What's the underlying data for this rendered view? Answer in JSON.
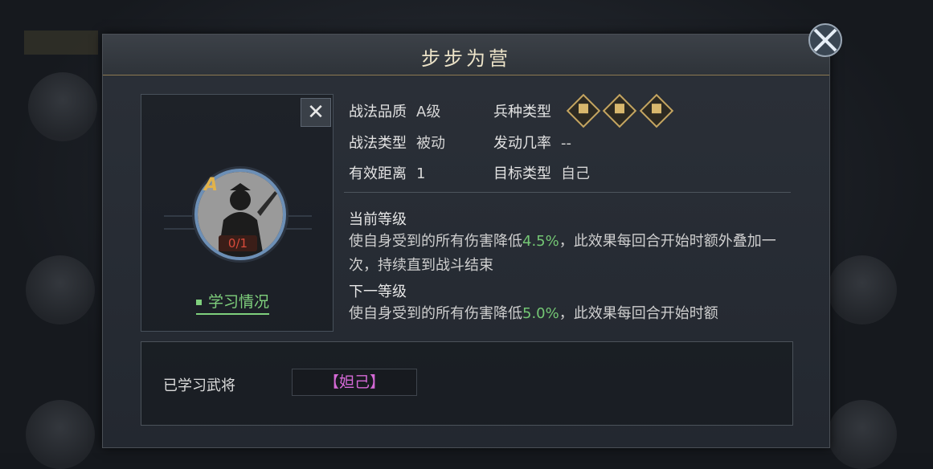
{
  "dialog": {
    "title": "步步为营"
  },
  "hero_card": {
    "grade": "A",
    "progress": "0/1",
    "study_label": "学习情况"
  },
  "info": {
    "quality_label": "战法品质",
    "quality_value": "A级",
    "unit_type_label": "兵种类型",
    "unit_icons": [
      "archer-icon",
      "shield-infantry-icon",
      "cavalry-icon"
    ],
    "tactic_type_label": "战法类型",
    "tactic_type_value": "被动",
    "trigger_rate_label": "发动几率",
    "trigger_rate_value": "--",
    "range_label": "有效距离",
    "range_value": "1",
    "target_label": "目标类型",
    "target_value": "自己"
  },
  "current_level": {
    "heading": "当前等级",
    "text_before": "使自身受到的所有伤害降低",
    "value": "4.5%",
    "text_after": "，此效果每回合开始时额外叠加一次，持续直到战斗结束"
  },
  "next_level": {
    "heading": "下一等级",
    "text_before": "使自身受到的所有伤害降低",
    "value": "5.0%",
    "text_after": "，此效果每回合开始时额"
  },
  "learned": {
    "label": "已学习武将",
    "value": "【妲己】"
  },
  "colors": {
    "accent_green": "#74c774",
    "gold": "#c4a561",
    "name_purple": "#d569d6"
  }
}
